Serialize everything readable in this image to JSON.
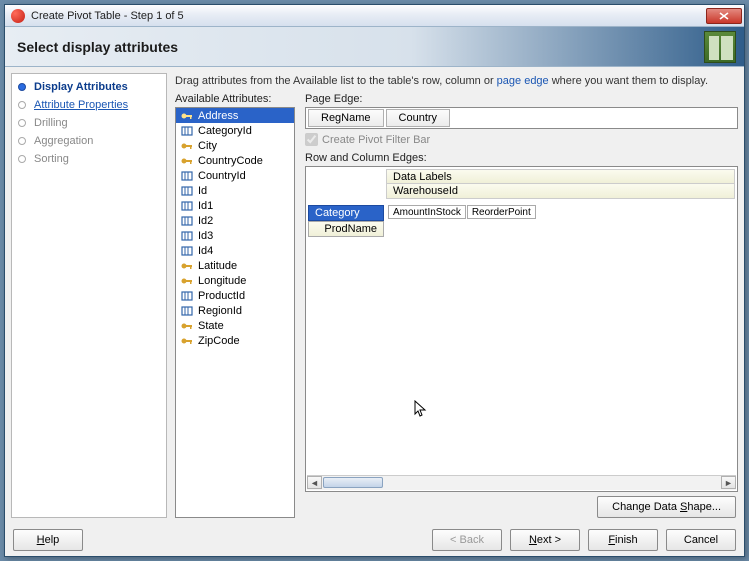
{
  "window": {
    "title": "Create Pivot Table - Step 1 of 5"
  },
  "header": {
    "title": "Select display attributes"
  },
  "sidebar": {
    "steps": [
      {
        "label": "Display Attributes",
        "state": "active"
      },
      {
        "label": "Attribute Properties",
        "state": "link"
      },
      {
        "label": "Drilling",
        "state": "disabled"
      },
      {
        "label": "Aggregation",
        "state": "disabled"
      },
      {
        "label": "Sorting",
        "state": "disabled"
      }
    ]
  },
  "instruction": {
    "prefix": "Drag attributes from the Available list to the table's row, column or ",
    "link": "page edge",
    "suffix": " where you want them to display."
  },
  "available": {
    "label": "Available Attributes:",
    "items": [
      {
        "label": "Address",
        "icon": "key",
        "selected": true
      },
      {
        "label": "CategoryId",
        "icon": "col"
      },
      {
        "label": "City",
        "icon": "key"
      },
      {
        "label": "CountryCode",
        "icon": "key"
      },
      {
        "label": "CountryId",
        "icon": "col"
      },
      {
        "label": "Id",
        "icon": "col"
      },
      {
        "label": "Id1",
        "icon": "col"
      },
      {
        "label": "Id2",
        "icon": "col"
      },
      {
        "label": "Id3",
        "icon": "col"
      },
      {
        "label": "Id4",
        "icon": "col"
      },
      {
        "label": "Latitude",
        "icon": "key"
      },
      {
        "label": "Longitude",
        "icon": "key"
      },
      {
        "label": "ProductId",
        "icon": "col"
      },
      {
        "label": "RegionId",
        "icon": "col"
      },
      {
        "label": "State",
        "icon": "key"
      },
      {
        "label": "ZipCode",
        "icon": "key"
      }
    ]
  },
  "page_edge": {
    "label": "Page Edge:",
    "items": [
      "RegName",
      "Country"
    ]
  },
  "filter_checkbox": {
    "label": "Create Pivot Filter Bar"
  },
  "edges": {
    "label": "Row and Column Edges:",
    "col_headers": [
      "Data Labels",
      "WarehouseId"
    ],
    "row_headers": [
      {
        "label": "Category",
        "selected": true
      },
      {
        "label": "ProdName",
        "selected": false
      }
    ],
    "data_cells": [
      "AmountInStock",
      "ReorderPoint"
    ]
  },
  "buttons": {
    "change_shape": "Change Data Shape...",
    "help": "Help",
    "back": "< Back",
    "next": "Next >",
    "finish": "Finish",
    "cancel": "Cancel"
  }
}
